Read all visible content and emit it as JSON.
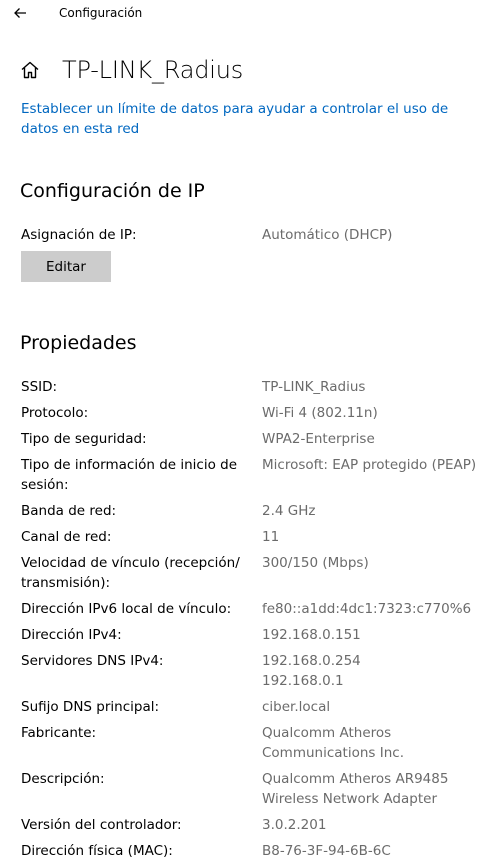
{
  "window": {
    "back_icon": "arrow-left-icon",
    "app_title": "Configuración"
  },
  "header": {
    "home_icon": "home-icon",
    "title": "TP-LINK_Radius"
  },
  "data_limit_link": "Establecer un límite de datos para ayudar a controlar el uso de datos en esta red",
  "ip_settings": {
    "title": "Configuración de IP",
    "assignment_label": "Asignación de IP:",
    "assignment_value": "Automático (DHCP)",
    "edit_label": "Editar"
  },
  "properties": {
    "title": "Propiedades",
    "rows": [
      {
        "label": "SSID:",
        "value": "TP-LINK_Radius"
      },
      {
        "label": "Protocolo:",
        "value": "Wi-Fi 4 (802.11n)"
      },
      {
        "label": "Tipo de seguridad:",
        "value": "WPA2-Enterprise"
      },
      {
        "label": "Tipo de información de inicio de sesión:",
        "value": "Microsoft: EAP protegido (PEAP)"
      },
      {
        "label": "Banda de red:",
        "value": "2.4 GHz"
      },
      {
        "label": "Canal de red:",
        "value": "11"
      },
      {
        "label": "Velocidad de vínculo (recepción/ transmisión):",
        "value": "300/150 (Mbps)"
      },
      {
        "label": "Dirección IPv6 local de vínculo:",
        "value": "fe80::a1dd:4dc1:7323:c770%6"
      },
      {
        "label": "Dirección IPv4:",
        "value": "192.168.0.151"
      },
      {
        "label": "Servidores DNS IPv4:",
        "value": "192.168.0.254\n192.168.0.1"
      },
      {
        "label": "Sufijo DNS principal:",
        "value": "ciber.local"
      },
      {
        "label": "Fabricante:",
        "value": "Qualcomm Atheros Communications Inc."
      },
      {
        "label": "Descripción:",
        "value": "Qualcomm Atheros AR9485 Wireless Network Adapter"
      },
      {
        "label": "Versión del controlador:",
        "value": "3.0.2.201"
      },
      {
        "label": "Dirección física (MAC):",
        "value": "B8-76-3F-94-6B-6C"
      }
    ]
  },
  "colors": {
    "link": "#0067c0",
    "value_text": "#6b6b6b",
    "button_bg": "#cccccc"
  }
}
